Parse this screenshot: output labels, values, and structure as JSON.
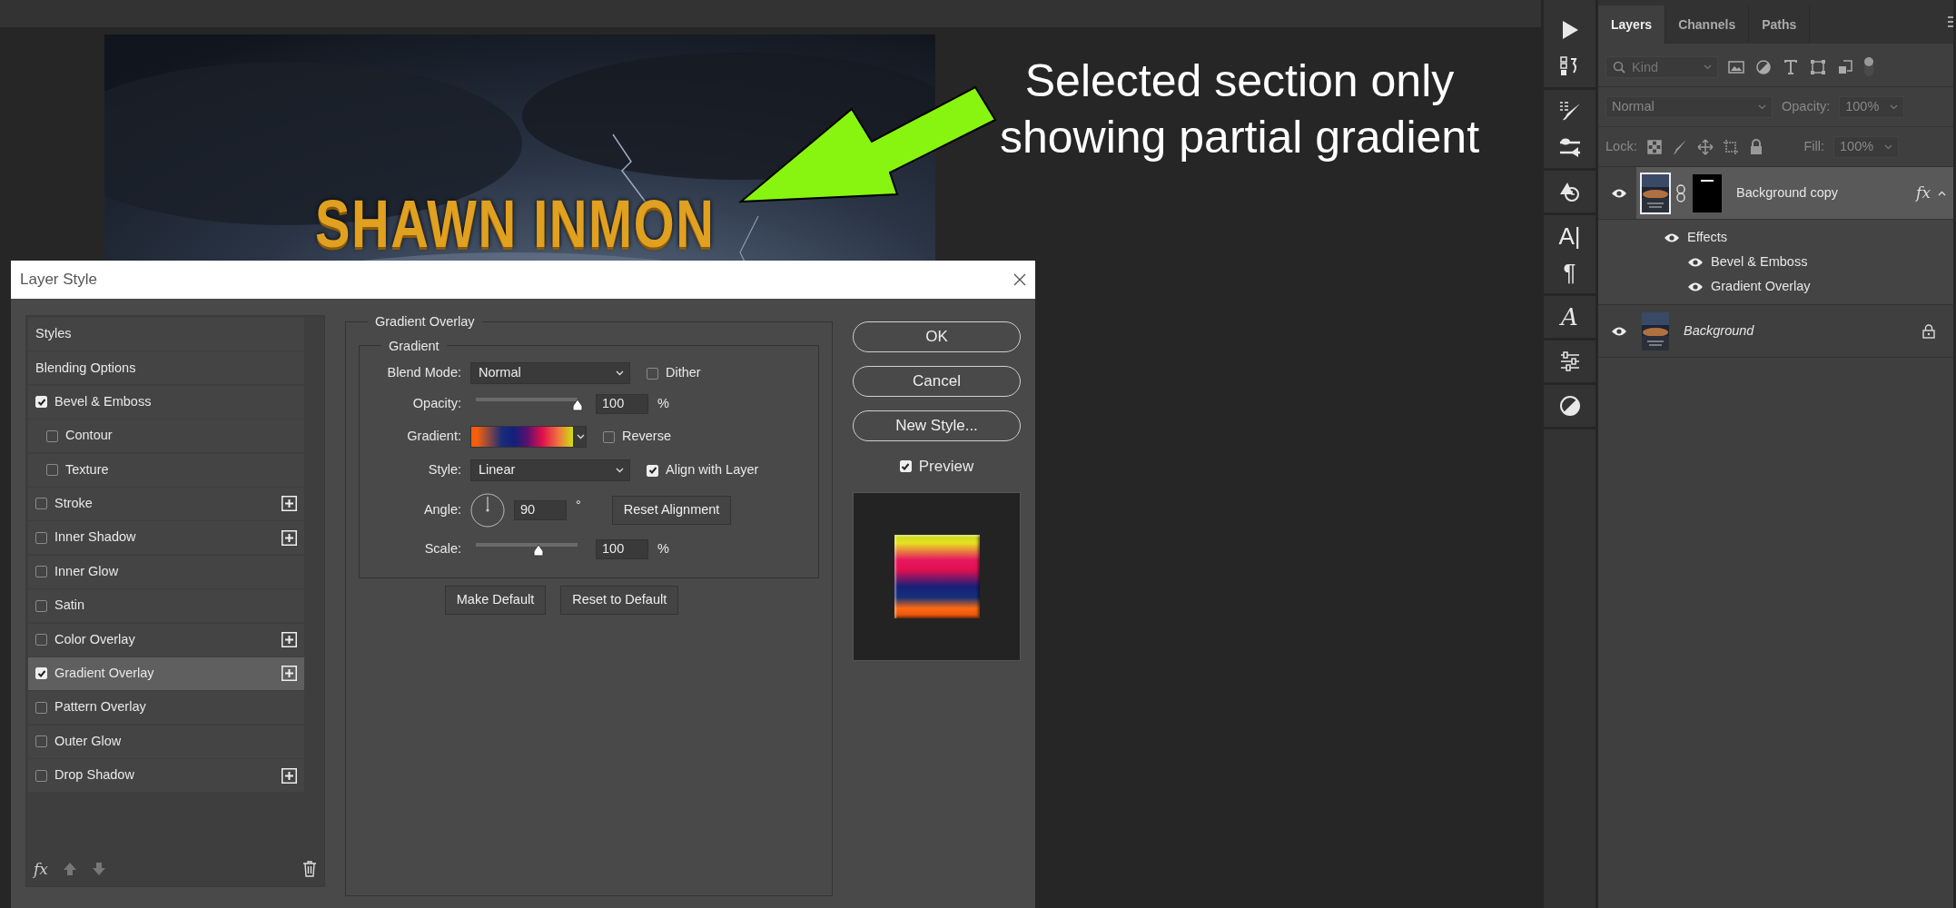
{
  "canvas": {
    "artwork_title": "SHAWN INMON",
    "annotation": "Selected section only showing partial gradient"
  },
  "dialog": {
    "title": "Layer Style",
    "styles": [
      {
        "label": "Styles",
        "kind": "plain",
        "selected": false
      },
      {
        "label": "Blending Options",
        "kind": "plain",
        "selected": false
      },
      {
        "label": "Bevel & Emboss",
        "kind": "check",
        "checked": true,
        "addable": false,
        "selected": false,
        "children": [
          {
            "label": "Contour",
            "kind": "check",
            "checked": false,
            "addable": false,
            "selected": false
          },
          {
            "label": "Texture",
            "kind": "check",
            "checked": false,
            "addable": false,
            "selected": false
          }
        ]
      },
      {
        "label": "Stroke",
        "kind": "check",
        "checked": false,
        "addable": true,
        "selected": false
      },
      {
        "label": "Inner Shadow",
        "kind": "check",
        "checked": false,
        "addable": true,
        "selected": false
      },
      {
        "label": "Inner Glow",
        "kind": "check",
        "checked": false,
        "addable": false,
        "selected": false
      },
      {
        "label": "Satin",
        "kind": "check",
        "checked": false,
        "addable": false,
        "selected": false
      },
      {
        "label": "Color Overlay",
        "kind": "check",
        "checked": false,
        "addable": true,
        "selected": false
      },
      {
        "label": "Gradient Overlay",
        "kind": "check",
        "checked": true,
        "addable": true,
        "selected": true
      },
      {
        "label": "Pattern Overlay",
        "kind": "check",
        "checked": false,
        "addable": false,
        "selected": false
      },
      {
        "label": "Outer Glow",
        "kind": "check",
        "checked": false,
        "addable": false,
        "selected": false
      },
      {
        "label": "Drop Shadow",
        "kind": "check",
        "checked": false,
        "addable": true,
        "selected": false
      }
    ],
    "fx_label": "fx",
    "section": "Gradient Overlay",
    "group": "Gradient",
    "blend_mode": {
      "label": "Blend Mode:",
      "value": "Normal"
    },
    "dither": {
      "label": "Dither",
      "checked": false
    },
    "opacity": {
      "label": "Opacity:",
      "level": 1.0,
      "value": "100",
      "unit": "%"
    },
    "gradient": {
      "label": "Gradient:"
    },
    "reverse": {
      "label": "Reverse",
      "checked": false
    },
    "style": {
      "label": "Style:",
      "value": "Linear"
    },
    "align": {
      "label": "Align with Layer",
      "checked": true
    },
    "angle": {
      "label": "Angle:",
      "value": "90",
      "unit": "°"
    },
    "reset_alignment": "Reset Alignment",
    "scale": {
      "label": "Scale:",
      "level": 0.62,
      "value": "100",
      "unit": "%"
    },
    "defaults": [
      "Make Default",
      "Reset to Default"
    ],
    "buttons": [
      "OK",
      "Cancel",
      "New Style..."
    ],
    "preview": {
      "label": "Preview",
      "checked": true
    }
  },
  "toolbar": {
    "character_glyph": "A|",
    "paragraph_glyph": "¶",
    "glyph_style_glyph": "A"
  },
  "layers_panel": {
    "tabs": [
      {
        "label": "Layers",
        "selected": true
      },
      {
        "label": "Channels",
        "selected": false
      },
      {
        "label": "Paths",
        "selected": false
      }
    ],
    "filter": {
      "placeholder": "Kind"
    },
    "blend_mode": "Normal",
    "opacity": {
      "label": "Opacity:",
      "value": "100%"
    },
    "lock": {
      "label": "Lock:"
    },
    "fill": {
      "label": "Fill:",
      "value": "100%"
    },
    "layers": [
      {
        "name": "Background copy",
        "visible": true,
        "selected": true,
        "locked": false,
        "fx": "fx",
        "effects": {
          "label": "Effects",
          "visible": true,
          "items": [
            {
              "label": "Bevel & Emboss",
              "visible": true
            },
            {
              "label": "Gradient Overlay",
              "visible": true
            }
          ]
        }
      },
      {
        "name": "Background",
        "visible": true,
        "selected": false,
        "locked": true
      }
    ]
  }
}
